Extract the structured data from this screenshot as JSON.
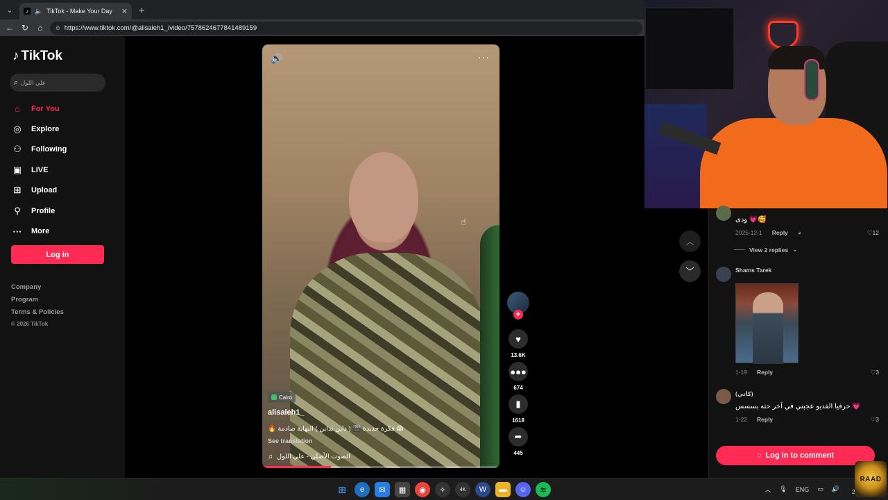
{
  "browser": {
    "tab_title": "TikTok - Make Your Day",
    "url": "https://www.tiktok.com/@alisaleh1_/video/7578624677841489159"
  },
  "sidebar": {
    "brand": "TikTok",
    "search_placeholder": "علي اللول",
    "nav": [
      {
        "label": "For You",
        "icon": "home-icon",
        "active": true
      },
      {
        "label": "Explore",
        "icon": "compass-icon",
        "active": false
      },
      {
        "label": "Following",
        "icon": "following-icon",
        "active": false
      },
      {
        "label": "LIVE",
        "icon": "live-icon",
        "active": false
      },
      {
        "label": "Upload",
        "icon": "upload-icon",
        "active": false
      },
      {
        "label": "Profile",
        "icon": "profile-icon",
        "active": false
      },
      {
        "label": "More",
        "icon": "more-dots-icon",
        "active": false
      }
    ],
    "login_label": "Log in",
    "footer": [
      "Company",
      "Program",
      "Terms & Policies"
    ],
    "copyright": "© 2026 TikTok"
  },
  "video": {
    "location": "Cairo",
    "username": "alisaleh1_",
    "caption": "😱 فكرة جديدة 🎬 ( داين تداين ) النهاية صادمة 🔥",
    "see_translation": "See translation",
    "sound": "الصوت الأصلي - علي اللول",
    "progress": 0.29
  },
  "actions": {
    "likes": "13.6K",
    "comments": "674",
    "saves": "1618",
    "shares": "445"
  },
  "comments": {
    "items": [
      {
        "name": "",
        "text": "ودى 💗🥰",
        "date": "2025-12-1",
        "reply": "Reply",
        "likes": "12"
      },
      {
        "view_replies": "View 2 replies"
      },
      {
        "name": "Shams Tarek",
        "date": "1-19",
        "reply": "Reply",
        "likes": "3"
      },
      {
        "name": "(كاتي)",
        "text": "حرفيا الفديو عجبني في آخر حته بسسس 💗",
        "date": "1-22",
        "reply": "Reply",
        "likes": "3"
      }
    ],
    "login_label": "Log in to comment"
  },
  "taskbar": {
    "lang": "ENG",
    "date": "2/1"
  },
  "overlay": {
    "badge": "RAAD"
  }
}
